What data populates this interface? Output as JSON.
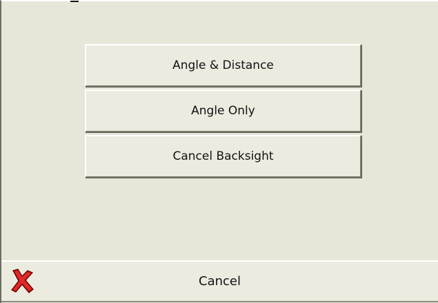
{
  "options": [
    {
      "label": "Angle & Distance"
    },
    {
      "label": "Angle Only"
    },
    {
      "label": "Cancel Backsight"
    }
  ],
  "footer": {
    "cancel_label": "Cancel",
    "cancel_icon": "red-x-icon"
  },
  "colors": {
    "background": "#e8e6d8",
    "button_face": "#ecebe0",
    "cancel_icon": "#d10f0f"
  }
}
